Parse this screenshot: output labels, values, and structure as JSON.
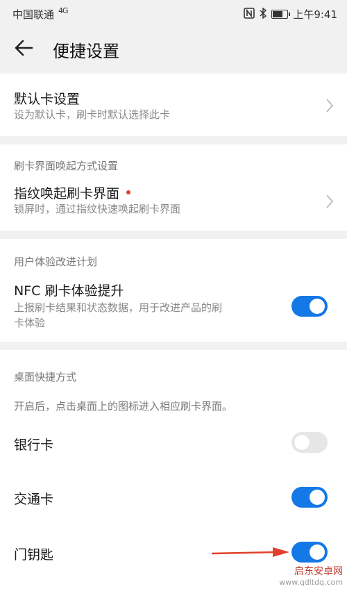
{
  "status": {
    "carrier": "中国联通",
    "network": "4G",
    "time": "上午9:41"
  },
  "header": {
    "title": "便捷设置"
  },
  "default_card": {
    "title": "默认卡设置",
    "subtitle": "设为默认卡，刷卡时默认选择此卡"
  },
  "wake": {
    "section": "刷卡界面唤起方式设置",
    "title": "指纹唤起刷卡界面",
    "subtitle": "锁屏时，通过指纹快速唤起刷卡界面"
  },
  "ux": {
    "section": "用户体验改进计划",
    "title": "NFC 刷卡体验提升",
    "subtitle_line1": "上报刷卡结果和状态数据，用于改进产品的刷",
    "subtitle_line2": "卡体验",
    "enabled": true
  },
  "shortcuts": {
    "section": "桌面快捷方式",
    "description": "开启后，点击桌面上的图标进入相应刷卡界面。",
    "items": [
      {
        "label": "银行卡",
        "enabled": false
      },
      {
        "label": "交通卡",
        "enabled": true
      },
      {
        "label": "门钥匙",
        "enabled": true
      }
    ]
  },
  "watermark": {
    "name": "启东安卓网",
    "url": "www.qdltdq.com"
  },
  "colors": {
    "accent": "#1478e6",
    "dot": "#e0402a",
    "arrow": "#e0402a"
  }
}
